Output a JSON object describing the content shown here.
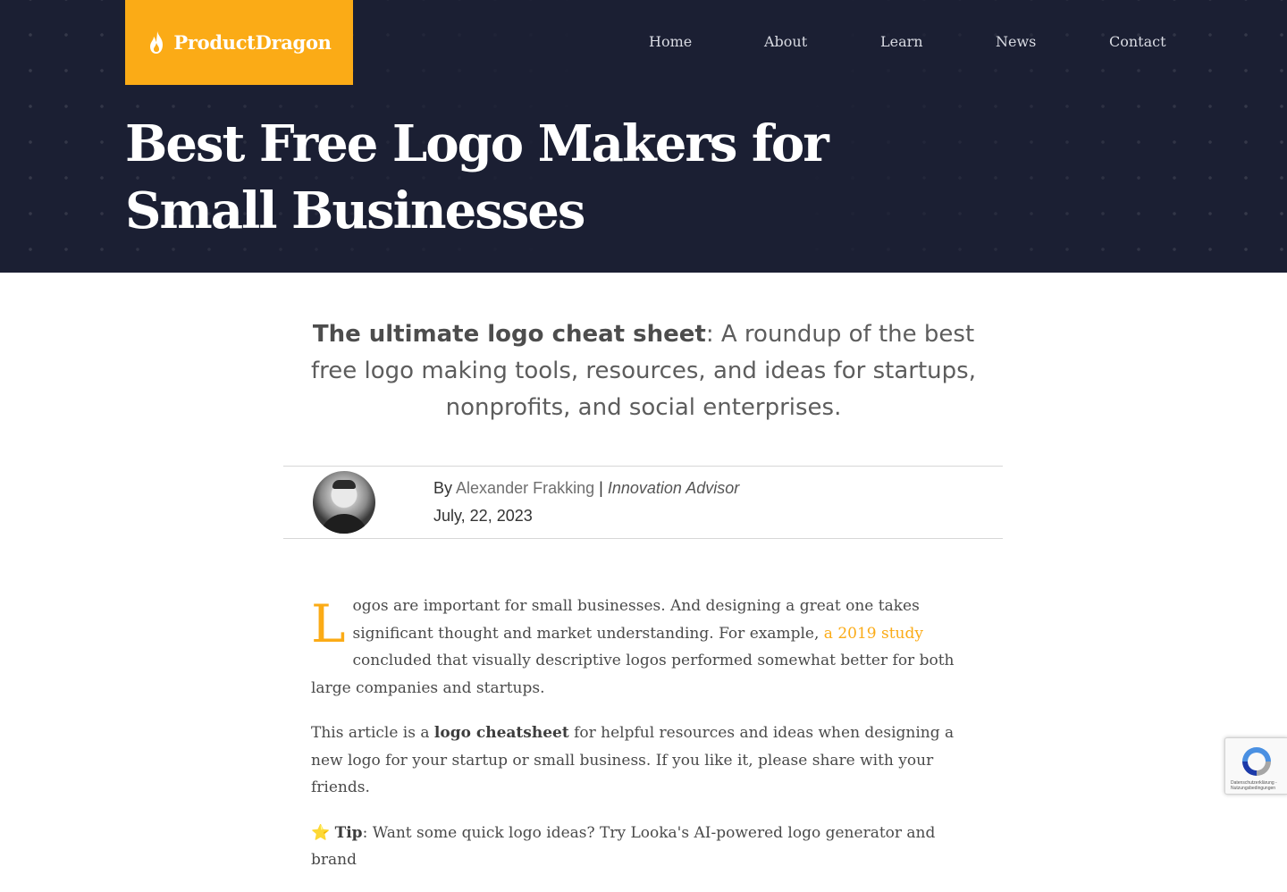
{
  "site": {
    "logo_text": "ProductDragon",
    "brand_color": "#fbab16",
    "header_bg": "#1b1f33"
  },
  "nav": {
    "items": [
      {
        "label": "Home"
      },
      {
        "label": "About"
      },
      {
        "label": "Learn"
      },
      {
        "label": "News"
      },
      {
        "label": "Contact"
      }
    ]
  },
  "page": {
    "title": "Best Free Logo Makers for Small Businesses"
  },
  "intro": {
    "strong": "The ultimate logo cheat sheet",
    "rest": ": A roundup of the best free logo making tools, resources, and ideas for startups, nonprofits, and social enterprises."
  },
  "author": {
    "by_label": "By",
    "name": "Alexander Frakking",
    "separator": "|",
    "role": "Innovation Advisor",
    "date": "July, 22, 2023",
    "avatar_icon": "author-photo"
  },
  "article": {
    "p1_dropcap": "L",
    "p1_text": "ogos are important for small businesses. And designing a great one takes significant thought and market understanding. For example, ",
    "p1_link": "a 2019 study",
    "p1_rest": " concluded that visually descriptive logos performed somewhat better for both large companies and startups.",
    "p2_pre": "This article is a ",
    "p2_bold": "logo cheatsheet",
    "p2_post": " for helpful resources and ideas when designing a new logo for your startup or small business. If you like it, please share with your friends.",
    "p3_icon": "⭐",
    "p3_bold": "Tip",
    "p3_text": ": Want some quick logo ideas? Try Looka's AI-powered logo generator and brand"
  },
  "recaptcha": {
    "text": "Datenschutzerklärung - Nutzungsbedingungen",
    "icon": "recaptcha-icon"
  }
}
